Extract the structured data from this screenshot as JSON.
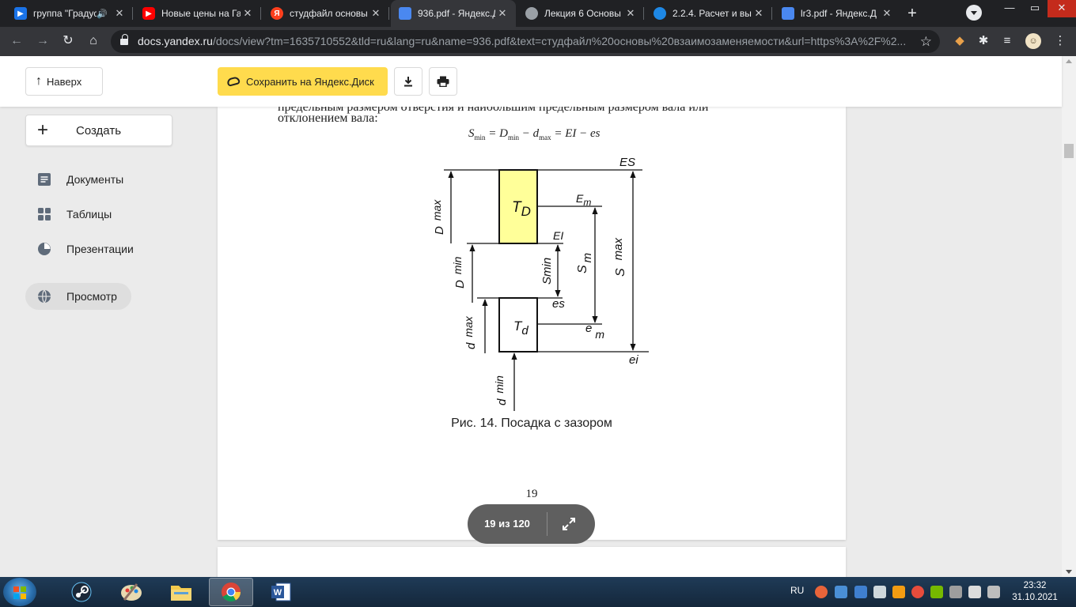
{
  "browser": {
    "tabs": [
      {
        "title": "группа \"Градус",
        "icon": "blue-play-icon",
        "audio": "🔊",
        "color": "#1a73e8"
      },
      {
        "title": "Новые цены на Га",
        "icon": "youtube-icon",
        "color": "#ff0000"
      },
      {
        "title": "студфайл основы",
        "icon": "yandex-icon",
        "color": "#fc3f1d",
        "glyph": "Я"
      },
      {
        "title": "936.pdf - Яндекс.Д",
        "icon": "yandex-docs-icon",
        "color": "#4a88f0",
        "active": true
      },
      {
        "title": "Лекция 6 Основы",
        "icon": "globe-icon",
        "color": "#9aa0a6"
      },
      {
        "title": "2.2.4. Расчет и вы",
        "icon": "studme-icon",
        "color": "#1e88e5"
      },
      {
        "title": "lr3.pdf - Яндекс.Д",
        "icon": "yandex-docs-icon",
        "color": "#4a88f0"
      }
    ],
    "close_glyph": "✕",
    "new_tab_glyph": "+",
    "window_controls": {
      "minimize": "—",
      "maximize": "▭",
      "close": "✕"
    },
    "url_host": "docs.yandex.ru",
    "url_rest": "/docs/view?tm=1635710552&tld=ru&lang=ru&name=936.pdf&text=студфайл%20основы%20взаимозаменяемости&url=https%3A%2F%2..."
  },
  "header": {
    "up_label": "Наверх",
    "save_label": "Сохранить на Яндекс.Диск"
  },
  "sidebar": {
    "create_label": "Создать",
    "items": [
      {
        "label": "Документы",
        "icon": "documents-icon"
      },
      {
        "label": "Таблицы",
        "icon": "tables-icon"
      },
      {
        "label": "Презентации",
        "icon": "presentations-icon"
      },
      {
        "label": "Просмотр",
        "icon": "globe-icon",
        "active": true
      }
    ]
  },
  "document": {
    "prev_line": "предельным размером отверстия и наибольшим предельным размером вала или",
    "text_line": "отклонением вала:",
    "formula": {
      "S": "S",
      "S_sub": "min",
      "eq1": " = ",
      "D": "D",
      "D_sub": "min",
      "minus": " − ",
      "d": "d",
      "d_sub": "max",
      "rest": " = EI − es"
    },
    "diagram_labels": {
      "TD": "T",
      "TD_sub": "D",
      "Td": "T",
      "Td_sub": "d",
      "ES": "ES",
      "EI": "EI",
      "es": "es",
      "ei": "ei",
      "Em": "E",
      "Em_sub": "m",
      "em": "e",
      "em_sub": "m",
      "Dmax": "D",
      "Dmax_sub": "max",
      "Dmin": "D",
      "Dmin_sub": "min",
      "dmax": "d",
      "dmax_sub": "max",
      "dmin": "d",
      "dmin_sub": "min",
      "Smin": "Smin",
      "Sm": "S",
      "Sm_sub": "m",
      "Smax": "S",
      "Smax_sub": "max"
    },
    "caption": "Рис. 14. Посадка с зазором",
    "page_number": "19"
  },
  "pager": {
    "text": "19 из 120"
  },
  "taskbar": {
    "lang": "RU",
    "time": "23:32",
    "date": "31.10.2021"
  },
  "colors": {
    "accent_yellow": "#ffdb4d",
    "hole_tolerance_fill": "#ffff99"
  }
}
